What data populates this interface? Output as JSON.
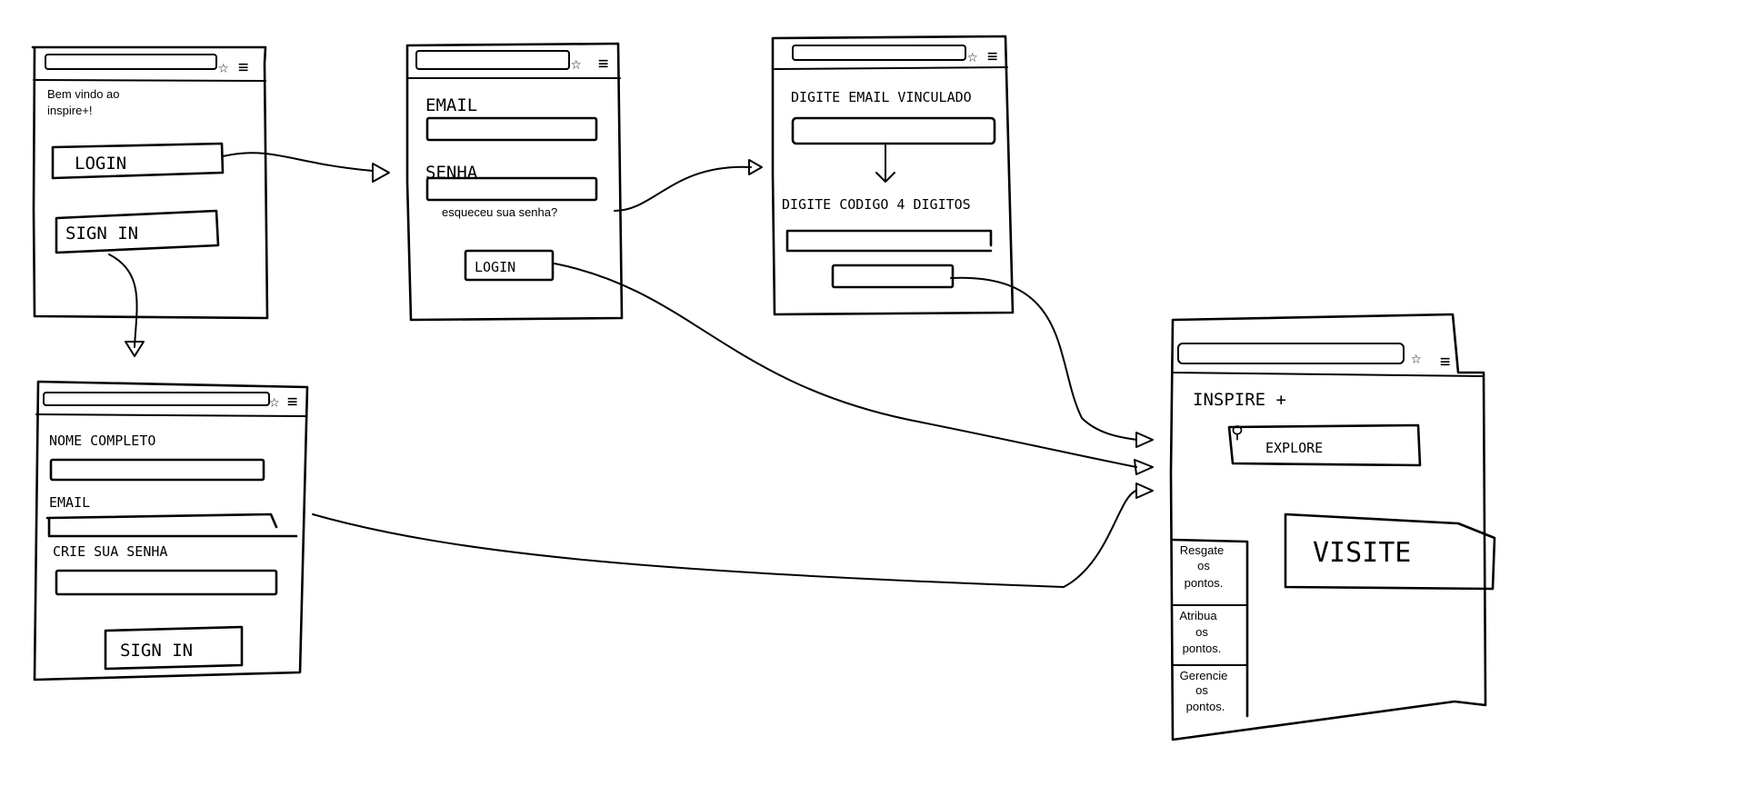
{
  "welcome_screen": {
    "greeting_line1": "Bem vindo ao",
    "greeting_line2": "inspire+!",
    "login_button": "LOGIN",
    "signin_button": "SIGN IN"
  },
  "login_screen": {
    "email_label": "EMAIL",
    "password_label": "SENHA",
    "forgot_password": "esqueceu sua senha?",
    "login_button": "LOGIN"
  },
  "recovery_screen": {
    "email_label": "DIGITE EMAIL VINCULADO",
    "code_label": "DIGITE CODIGO 4 DIGITOS"
  },
  "signup_screen": {
    "name_label": "NOME COMPLETO",
    "email_label": "EMAIL",
    "password_label": "CRIE SUA SENHA",
    "signin_button": "SIGN IN"
  },
  "home_screen": {
    "title": "INSPIRE +",
    "explore_label": "EXPLORE",
    "visit_label": "VISITE",
    "menu": [
      {
        "line1": "Resgate",
        "line2": "os",
        "line3": "pontos."
      },
      {
        "line1": "Atribua",
        "line2": "os",
        "line3": "pontos."
      },
      {
        "line1": "Gerencie",
        "line2": "os",
        "line3": "pontos."
      }
    ]
  }
}
